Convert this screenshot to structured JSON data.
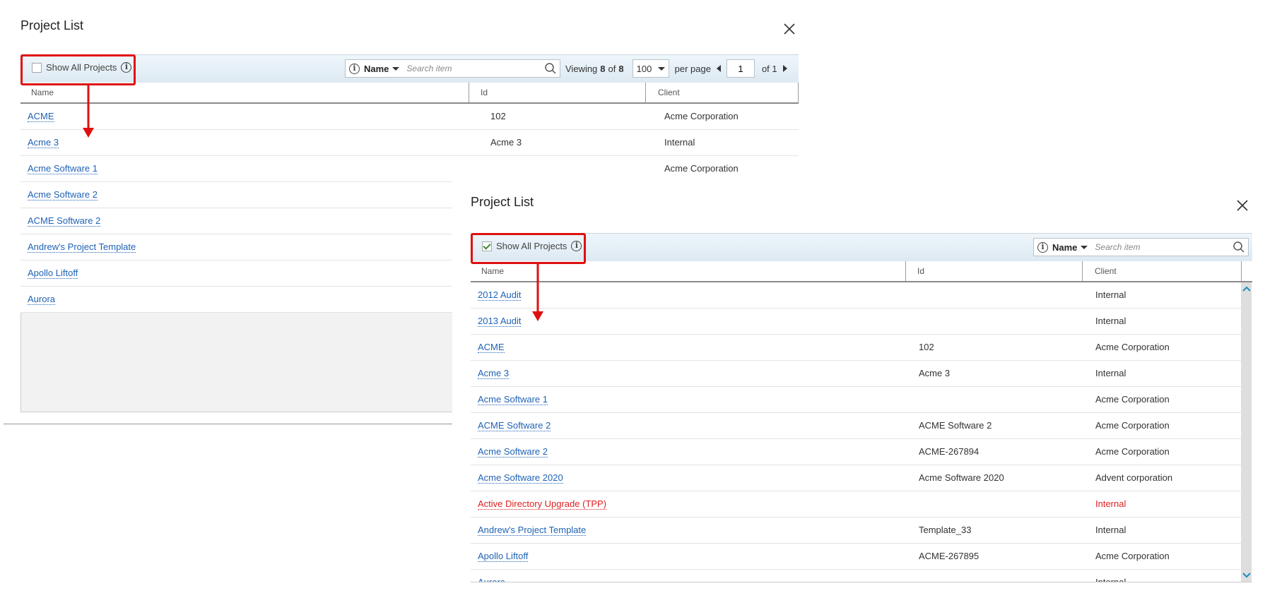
{
  "colors": {
    "link": "#1f62b5",
    "warning": "#e02020",
    "highlight": "#e01010",
    "toolbar_bg": "#dde9f2"
  },
  "panel_a": {
    "title": "Project List",
    "show_all_label": "Show All Projects",
    "show_all_checked": false,
    "search": {
      "field": "Name",
      "placeholder": "Search item",
      "info_glyph": "i"
    },
    "pager": {
      "viewing_label": "Viewing",
      "shown": "8",
      "of_word": "of",
      "total": "8",
      "per_page_value": "100",
      "per_page_label": "per page",
      "page": "1",
      "of_pages": "of 1"
    },
    "columns": {
      "name": "Name",
      "id": "Id",
      "client": "Client"
    },
    "rows": [
      {
        "name": "ACME",
        "id": "102",
        "client": "Acme Corporation"
      },
      {
        "name": "Acme 3",
        "id": "Acme 3",
        "client": "Internal"
      },
      {
        "name": "Acme Software 1",
        "id": "",
        "client": "Acme Corporation"
      },
      {
        "name": "Acme Software 2",
        "id": "",
        "client": ""
      },
      {
        "name": "ACME Software 2",
        "id": "",
        "client": ""
      },
      {
        "name": "Andrew's Project Template",
        "id": "",
        "client": ""
      },
      {
        "name": "Apollo Liftoff",
        "id": "",
        "client": ""
      },
      {
        "name": "Aurora",
        "id": "",
        "client": ""
      }
    ]
  },
  "panel_b": {
    "title": "Project List",
    "show_all_label": "Show All Projects",
    "show_all_checked": true,
    "search": {
      "field": "Name",
      "placeholder": "Search item",
      "info_glyph": "i"
    },
    "columns": {
      "name": "Name",
      "id": "Id",
      "client": "Client"
    },
    "rows": [
      {
        "name": "2012 Audit",
        "id": "",
        "client": "Internal",
        "warn": false
      },
      {
        "name": "2013 Audit",
        "id": "",
        "client": "Internal",
        "warn": false
      },
      {
        "name": "ACME",
        "id": "102",
        "client": "Acme Corporation",
        "warn": false
      },
      {
        "name": "Acme 3",
        "id": "Acme 3",
        "client": "Internal",
        "warn": false
      },
      {
        "name": "Acme Software 1",
        "id": "",
        "client": "Acme Corporation",
        "warn": false
      },
      {
        "name": "ACME Software 2",
        "id": "ACME Software 2",
        "client": "Acme Corporation",
        "warn": false
      },
      {
        "name": "Acme Software 2",
        "id": "ACME-267894",
        "client": "Acme Corporation",
        "warn": false
      },
      {
        "name": "Acme Software 2020",
        "id": "Acme Software 2020",
        "client": "Advent corporation",
        "warn": false
      },
      {
        "name": "Active Directory Upgrade (TPP)",
        "id": "",
        "client": "Internal",
        "warn": true
      },
      {
        "name": "Andrew's Project Template",
        "id": "Template_33",
        "client": "Internal",
        "warn": false
      },
      {
        "name": "Apollo Liftoff",
        "id": "ACME-267895",
        "client": "Acme Corporation",
        "warn": false
      },
      {
        "name": "Aurora",
        "id": "",
        "client": "Internal",
        "warn": false
      }
    ]
  }
}
